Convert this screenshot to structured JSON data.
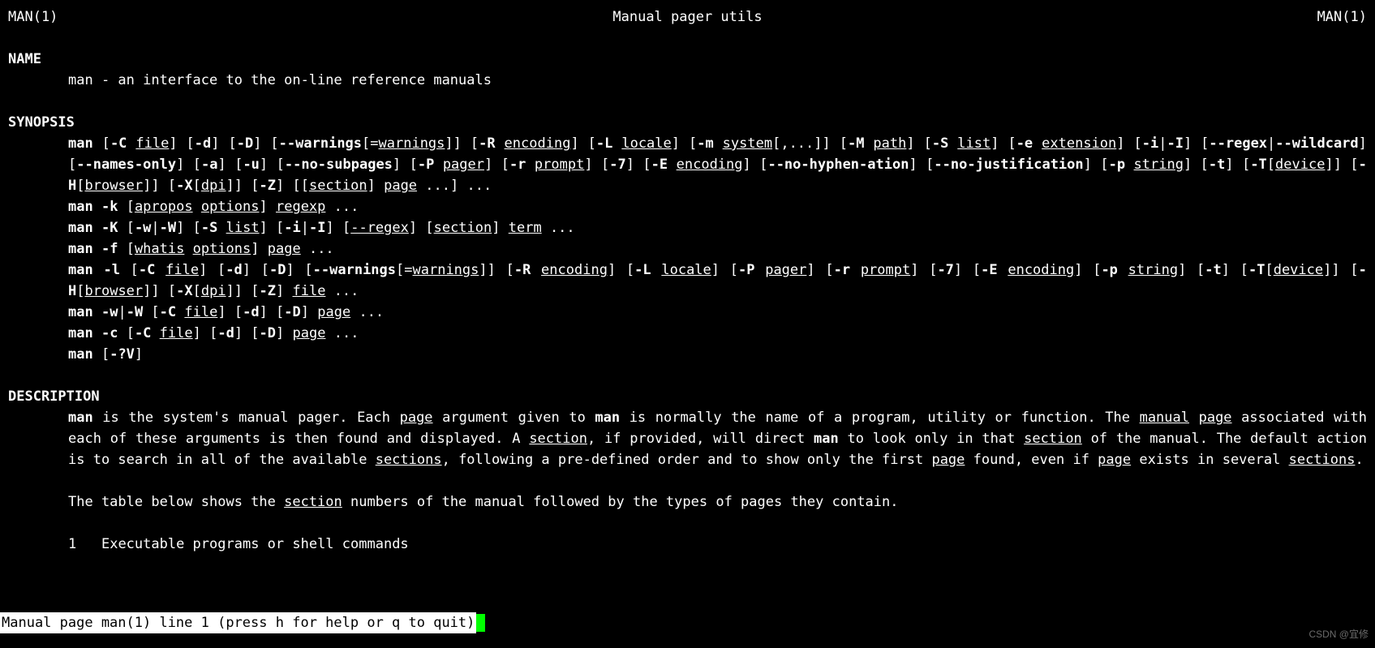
{
  "header": {
    "left": "MAN(1)",
    "center": "Manual pager utils",
    "right": "MAN(1)"
  },
  "name": {
    "title": "NAME",
    "text": "man - an interface to the on-line reference manuals"
  },
  "synopsis": {
    "title": "SYNOPSIS",
    "options": {
      "C": "-C",
      "d": "-d",
      "D": "-D",
      "warnings": "--warnings",
      "warnings_arg": "warnings",
      "R": "-R",
      "L": "-L",
      "m": "-m",
      "M": "-M",
      "S": "-S",
      "e": "-e",
      "i": "-i",
      "I": "-I",
      "regex": "--regex",
      "wildcard": "--wildcard",
      "names_only": "--names-only",
      "a": "-a",
      "u": "-u",
      "no_subpages": "--no-subpages",
      "P": "-P",
      "r": "-r",
      "seven": "-7",
      "E": "-E",
      "no_hyphen1": "--no-hyphen-",
      "no_hyphen2": "ation",
      "no_just": "--no-justification",
      "p": "-p",
      "t": "-t",
      "T": "-T",
      "H": "-H",
      "X": "-X",
      "Z": "-Z",
      "k": "-k",
      "K": "-K",
      "w": "-w",
      "W": "-W",
      "regex2": "--regex",
      "f": "-f",
      "l": "-l",
      "c": "-c",
      "qv": "-?V"
    },
    "args": {
      "file": "file",
      "encoding": "encoding",
      "locale": "locale",
      "system": "system",
      "path": "path",
      "list": "list",
      "extension": "extension",
      "pager": "pager",
      "prompt": "prompt",
      "string": "string",
      "device": "device",
      "browser": "browser",
      "dpi": "dpi",
      "section": "section",
      "page": "page",
      "apropos": "apropos",
      "options": "options",
      "regexp": "regexp",
      "term": "term",
      "whatis": "whatis"
    },
    "cmd": "man",
    "etc": "[,...]]",
    "ellipsis": "...",
    "pipe": "|"
  },
  "description": {
    "title": "DESCRIPTION",
    "d1a": " is the system's manual pager. Each ",
    "d1b": " argument given to ",
    "d1c": " is normally the name of a program, utility  or  function.   The ",
    "d2a": "  ",
    "d2b": " associated with each of these arguments is then found and displayed. A ",
    "d2c": ", if provided, will direct ",
    "d2d": " to look only in that ",
    "d2e": " of the manual.  The default action is to search in all of the available ",
    "d2f": ",  following  a  pre-defined order and to show only the first ",
    "d2g": " found, even if ",
    "d2h": " exists in several ",
    "d2i": ".",
    "d3a": "The table below shows the ",
    "d3b": " numbers of the manual followed by the types of pages they contain.",
    "table": {
      "num": "1",
      "desc": "Executable programs or shell commands"
    },
    "words": {
      "man": "man",
      "page": "page",
      "manual": "manual",
      "section": "section",
      "sections": "sections"
    }
  },
  "status": " Manual page man(1) line 1 (press h for help or q to quit)",
  "watermark": "CSDN @宜修"
}
